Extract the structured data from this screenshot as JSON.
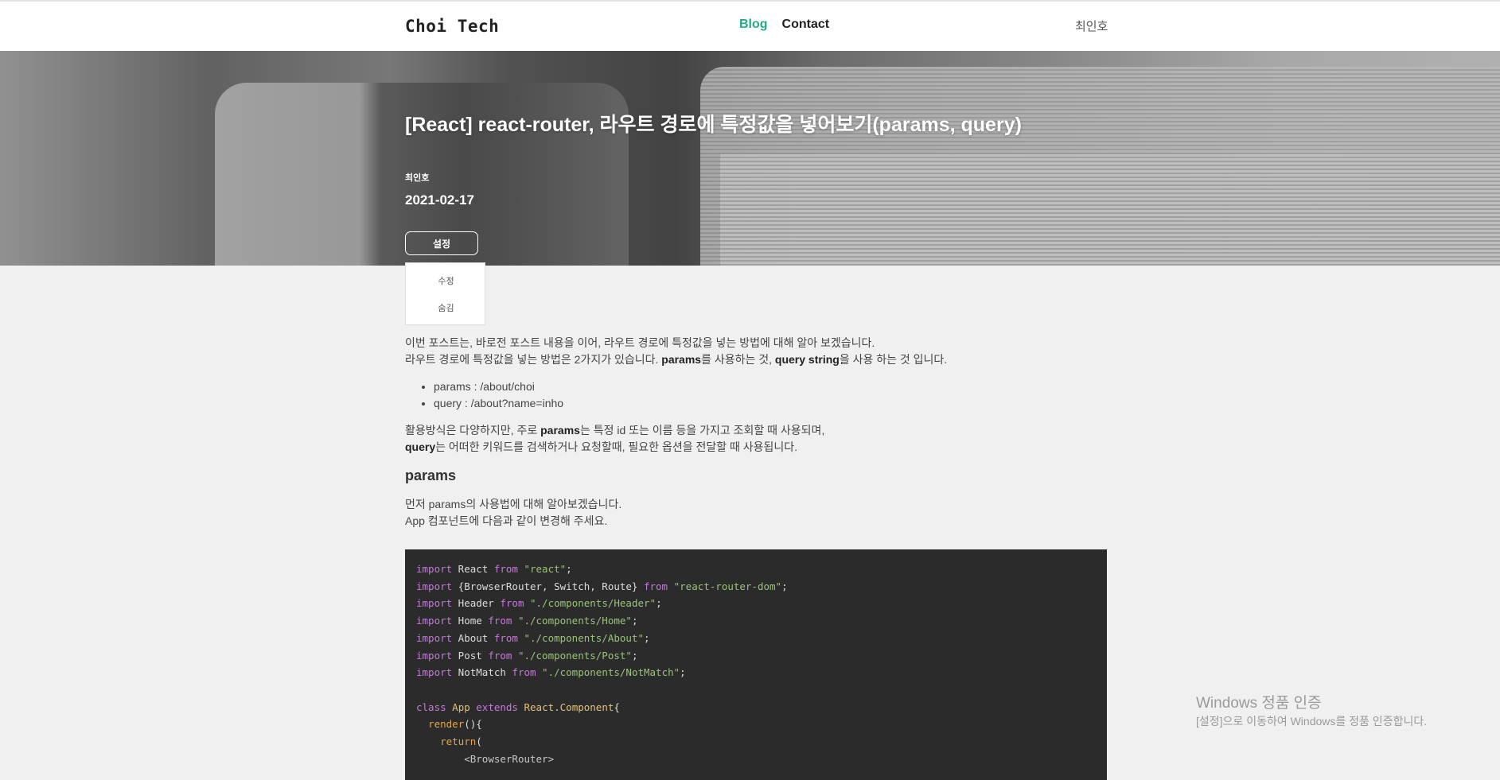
{
  "header": {
    "logo": "Choi Tech",
    "nav": [
      {
        "label": "Blog",
        "active": true
      },
      {
        "label": "Contact",
        "active": false
      }
    ],
    "user": "최인호",
    "active_color": "#1fab89"
  },
  "hero": {
    "title": "[React] react-router, 라우트 경로에 특정값을 넣어보기(params, query)",
    "author": "최인호",
    "date": "2021-02-17",
    "settings_label": "설정"
  },
  "settings_menu": {
    "items": [
      "수정",
      "숨김"
    ]
  },
  "content": {
    "intro_line1": "이번 포스트는, 바로전 포스트 내용을 이어, 라우트 경로에 특정값을 넣는 방법에 대해 알아 보겠습니다.",
    "intro_line2_a": "라우트 경로에 특정값을 넣는 방법은 2가지가 있습니다. ",
    "intro_line2_b": "params",
    "intro_line2_c": "를 사용하는 것, ",
    "intro_line2_d": "query string",
    "intro_line2_e": "을 사용 하는 것 입니다.",
    "list": [
      "params : /about/choi",
      "query : /about?name=inho"
    ],
    "usage_line1_a": "활용방식은 다양하지만, 주로 ",
    "usage_line1_b": "params",
    "usage_line1_c": "는 특정 id 또는 이름 등을 가지고 조회할 때 사용되며,",
    "usage_line2_a": "query",
    "usage_line2_b": "는 어떠한 키워드를 검색하거나 요청할때, 필요한 옵션을 전달할 때 사용됩니다.",
    "heading": "params",
    "params_line1": "먼저 params의 사용법에 대해 알아보겠습니다.",
    "params_line2": "App 컴포넌트에 다음과 같이 변경해 주세요."
  },
  "code": {
    "imports": [
      {
        "kw": "import",
        "name": " React ",
        "from": "from",
        "path": " \"react\"",
        "end": ";"
      },
      {
        "kw": "import",
        "name": " {BrowserRouter, Switch, Route} ",
        "from": "from",
        "path": " \"react-router-dom\"",
        "end": ";"
      },
      {
        "kw": "import",
        "name": " Header ",
        "from": "from",
        "path": " \"./components/Header\"",
        "end": ";"
      },
      {
        "kw": "import",
        "name": " Home ",
        "from": "from",
        "path": " \"./components/Home\"",
        "end": ";"
      },
      {
        "kw": "import",
        "name": " About ",
        "from": "from",
        "path": " \"./components/About\"",
        "end": ";"
      },
      {
        "kw": "import",
        "name": " Post ",
        "from": "from",
        "path": " \"./components/Post\"",
        "end": ";"
      },
      {
        "kw": "import",
        "name": " NotMatch ",
        "from": "from",
        "path": " \"./components/NotMatch\"",
        "end": ";"
      }
    ],
    "class_kw": "class",
    "class_name": "App",
    "extends_kw": "extends",
    "base": "React.Component",
    "brace": "{",
    "render": "render",
    "render_rest": "(){",
    "return_kw": "return",
    "return_rest": "(",
    "tag": "<BrowserRouter>"
  },
  "watermark": {
    "line1": "Windows 정품 인증",
    "line2": "[설정]으로 이동하여 Windows를 정품 인증합니다."
  }
}
